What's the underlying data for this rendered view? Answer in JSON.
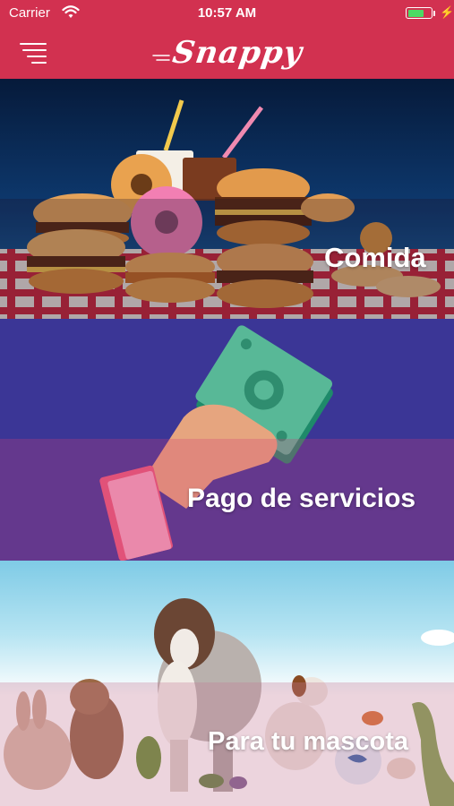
{
  "status_bar": {
    "carrier": "Carrier",
    "time": "10:57 AM",
    "battery_level": 0.75
  },
  "nav": {
    "logo": "Snappy"
  },
  "categories": [
    {
      "label": "Comida"
    },
    {
      "label": "Pago de servicios"
    },
    {
      "label": "Para tu mascota"
    }
  ],
  "colors": {
    "brand": "#d23150",
    "battery": "#4cd964",
    "services_bg": "#3b3696"
  }
}
